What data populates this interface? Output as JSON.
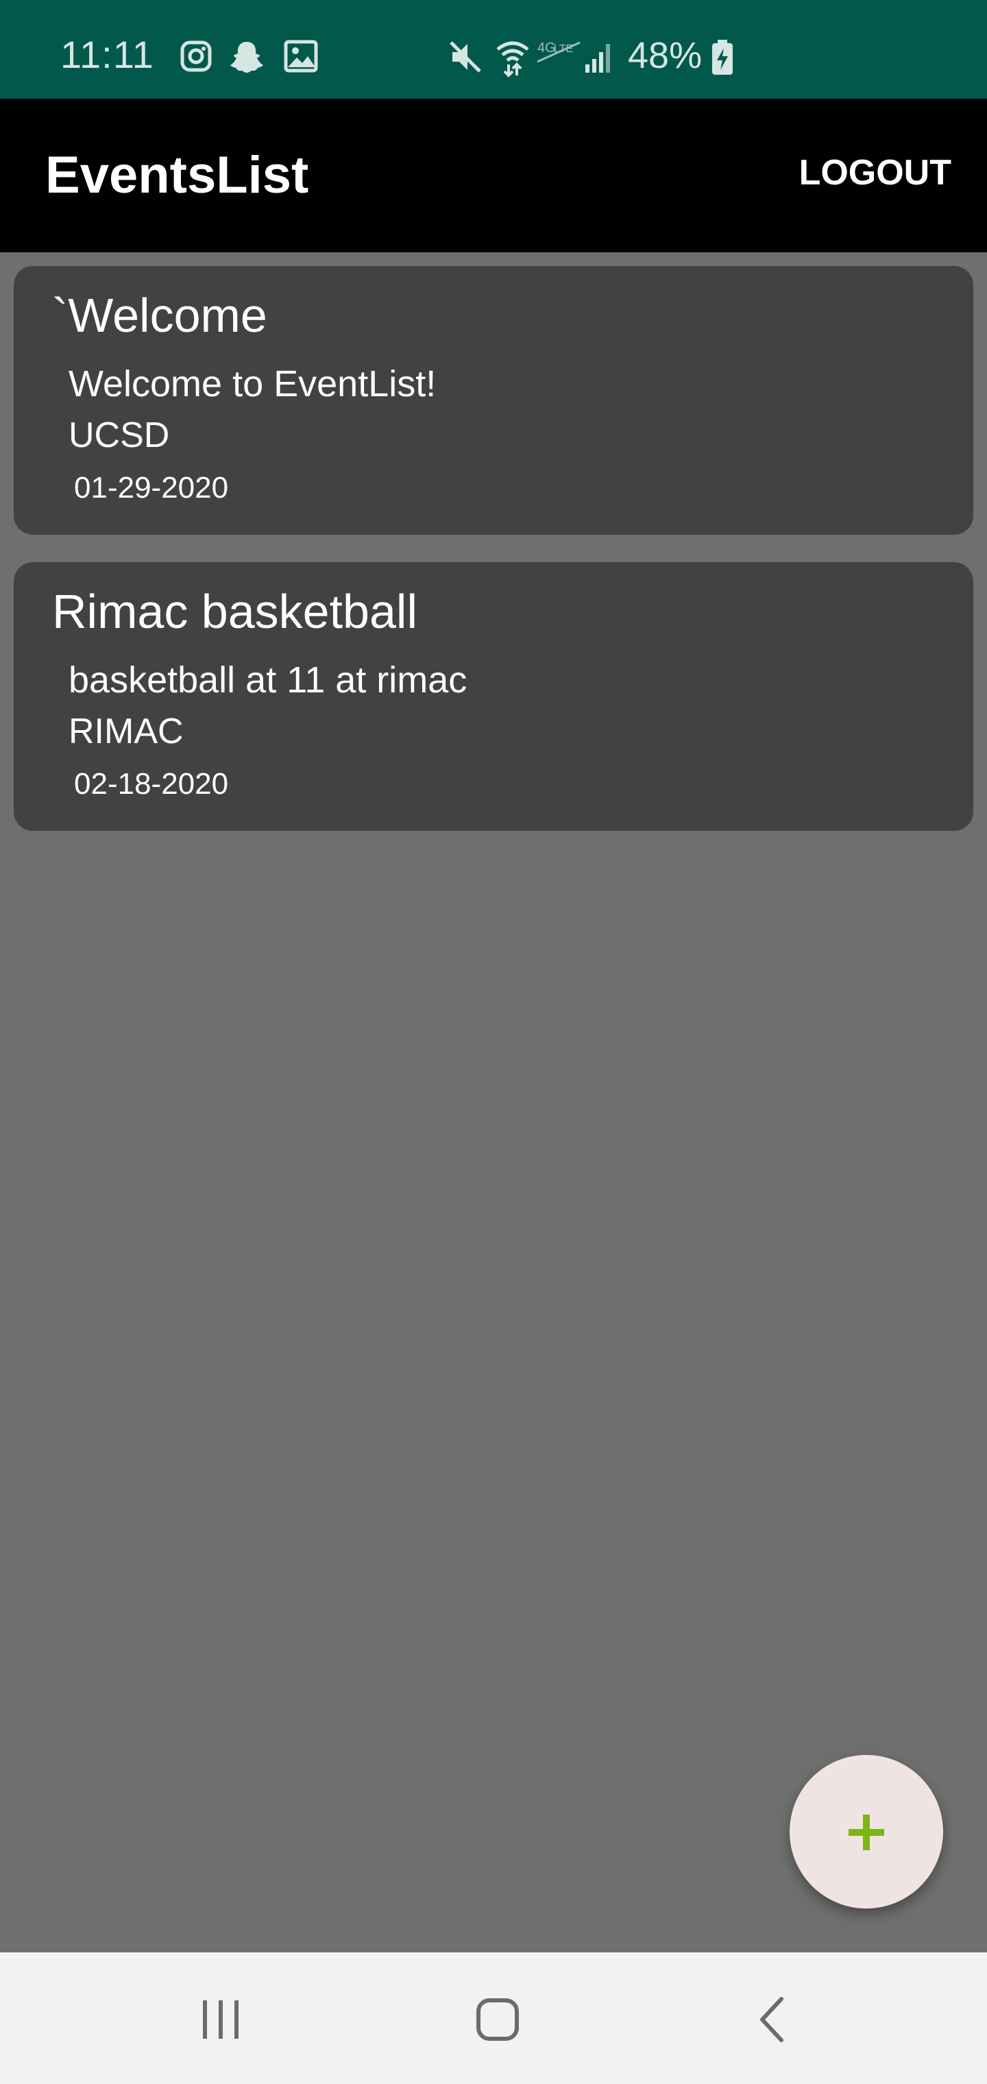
{
  "status_bar": {
    "time": "11:11",
    "battery": "48%",
    "icons": [
      "instagram-icon",
      "snapchat-icon",
      "gallery-icon",
      "mute-icon",
      "wifi-icon",
      "volte-icon",
      "signal-icon",
      "battery-charging-icon"
    ]
  },
  "app_bar": {
    "title": "EventsList",
    "logout_label": "LOGOUT"
  },
  "events": [
    {
      "title": "`Welcome",
      "description": "Welcome to EventList!",
      "location": "UCSD",
      "date": "01-29-2020"
    },
    {
      "title": "Rimac basketball",
      "description": "basketball at 11 at rimac",
      "location": "RIMAC",
      "date": "02-18-2020"
    }
  ],
  "fab": {
    "icon": "plus-icon",
    "accent_color": "#7cb518"
  },
  "nav_bar": {
    "icons": [
      "recents-icon",
      "home-icon",
      "back-icon"
    ]
  },
  "colors": {
    "status_bar": "#03584c",
    "app_bar": "#000000",
    "background": "#706f70",
    "card": "#414242",
    "fab": "#f0e4e3"
  }
}
